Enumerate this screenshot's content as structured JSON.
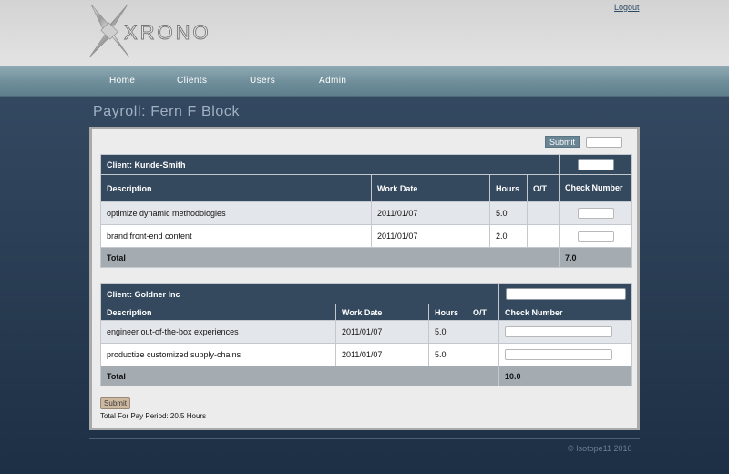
{
  "header": {
    "logo_text": "XRONO",
    "logout_label": "Logout"
  },
  "nav": {
    "items": [
      {
        "label": "Home"
      },
      {
        "label": "Clients"
      },
      {
        "label": "Users"
      },
      {
        "label": "Admin"
      }
    ]
  },
  "page_title": "Payroll: Fern F Block",
  "toolbar": {
    "submit_label": "Submit",
    "check_value": ""
  },
  "clients": [
    {
      "title": "Client: Kunde-Smith",
      "columns": [
        "Description",
        "Work Date",
        "Hours",
        "O/T",
        "Check Number"
      ],
      "rows": [
        {
          "description": "optimize dynamic methodologies",
          "work_date": "2011/01/07",
          "hours": "5.0",
          "ot": ""
        },
        {
          "description": "brand front-end content",
          "work_date": "2011/01/07",
          "hours": "2.0",
          "ot": ""
        }
      ],
      "total_label": "Total",
      "total_value": "7.0"
    },
    {
      "title": "Client: Goldner Inc",
      "columns": [
        "Description",
        "Work Date",
        "Hours",
        "O/T",
        "Check Number"
      ],
      "rows": [
        {
          "description": "engineer out-of-the-box experiences",
          "work_date": "2011/01/07",
          "hours": "5.0",
          "ot": ""
        },
        {
          "description": "productize customized supply-chains",
          "work_date": "2011/01/07",
          "hours": "5.0",
          "ot": ""
        }
      ],
      "total_label": "Total",
      "total_value": "10.0"
    }
  ],
  "footer_submit_label": "Submit",
  "total_for_period": "Total For Pay Period: 20.5 Hours",
  "copyright": "© Isotope11 2010",
  "colors": {
    "header_bg": "#dcdcdc",
    "nav_bg": "#7797a3",
    "table_header": "#34495e",
    "total_row": "#a4acb2",
    "page_bg": "#2b3f56"
  }
}
